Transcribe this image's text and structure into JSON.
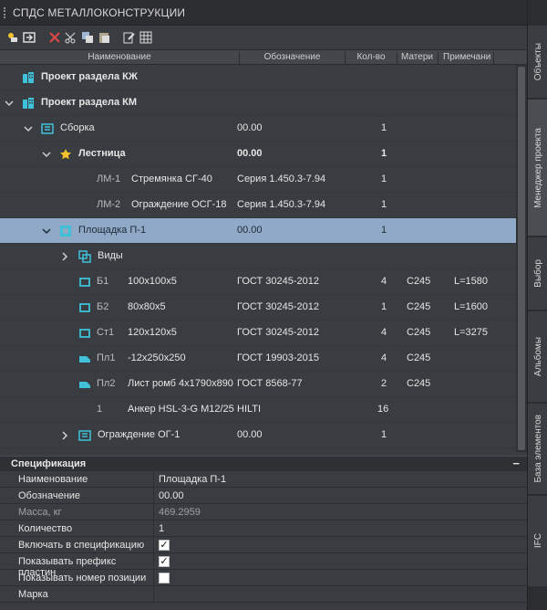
{
  "window": {
    "title": "СПДС МЕТАЛЛОКОНСТРУКЦИИ"
  },
  "columns": {
    "name": "Наименование",
    "designation": "Обозначение",
    "qty": "Кол-во",
    "material": "Матери",
    "note": "Примечани"
  },
  "tree": {
    "rows": [
      {
        "prefix": "",
        "name": "Проект раздела КЖ",
        "designation": "",
        "qty": "",
        "material": "",
        "note": ""
      },
      {
        "prefix": "",
        "name": "Проект раздела КМ",
        "designation": "",
        "qty": "",
        "material": "",
        "note": ""
      },
      {
        "prefix": "",
        "name": "Сборка",
        "designation": "00.00",
        "qty": "1",
        "material": "",
        "note": ""
      },
      {
        "prefix": "",
        "name": "Лестница",
        "designation": "00.00",
        "qty": "1",
        "material": "",
        "note": ""
      },
      {
        "prefix": "ЛМ-1",
        "name": "Стремянка СГ-40",
        "designation": "Серия 1.450.3-7.94",
        "qty": "1",
        "material": "",
        "note": ""
      },
      {
        "prefix": "ЛМ-2",
        "name": "Ограждение ОСГ-18",
        "designation": "Серия 1.450.3-7.94",
        "qty": "1",
        "material": "",
        "note": ""
      },
      {
        "prefix": "",
        "name": "Площадка П-1",
        "designation": "00.00",
        "qty": "1",
        "material": "",
        "note": ""
      },
      {
        "prefix": "",
        "name": "Виды",
        "designation": "",
        "qty": "",
        "material": "",
        "note": ""
      },
      {
        "prefix": "Б1",
        "name": "100x100x5",
        "designation": "ГОСТ 30245-2012",
        "qty": "4",
        "material": "С245",
        "note": "L=1580"
      },
      {
        "prefix": "Б2",
        "name": "80x80x5",
        "designation": "ГОСТ 30245-2012",
        "qty": "1",
        "material": "С245",
        "note": "L=1600"
      },
      {
        "prefix": "Ст1",
        "name": "120x120x5",
        "designation": "ГОСТ 30245-2012",
        "qty": "4",
        "material": "С245",
        "note": "L=3275"
      },
      {
        "prefix": "Пл1",
        "name": "-12x250x250",
        "designation": "ГОСТ 19903-2015",
        "qty": "4",
        "material": "С245",
        "note": ""
      },
      {
        "prefix": "Пл2",
        "name": "Лист ромб 4x1790x890",
        "designation": "ГОСТ 8568-77",
        "qty": "2",
        "material": "С245",
        "note": ""
      },
      {
        "prefix": "1",
        "name": "Анкер HSL-3-G M12/25",
        "designation": "HILTI",
        "qty": "16",
        "material": "",
        "note": ""
      },
      {
        "prefix": "",
        "name": "Ограждение ОГ-1",
        "designation": "00.00",
        "qty": "1",
        "material": "",
        "note": ""
      }
    ]
  },
  "spec": {
    "title": "Спецификация",
    "collapse": "−",
    "props": [
      {
        "key": "Наименование",
        "value": "Площадка П-1"
      },
      {
        "key": "Обозначение",
        "value": "00.00"
      },
      {
        "key": "Масса, кг",
        "value": "469.2959"
      },
      {
        "key": "Количество",
        "value": "1"
      },
      {
        "key": "Включать в спецификацию",
        "value": "✓"
      },
      {
        "key": "Показывать префикс пластин",
        "value": "✓"
      },
      {
        "key": "Показывать номер позиции",
        "value": ""
      },
      {
        "key": "Марка",
        "value": ""
      }
    ]
  },
  "sidetabs": [
    "Объекты",
    "Менеджер проекта",
    "Выбор",
    "Альбомы",
    "База элементов",
    "IFC"
  ],
  "colors": {
    "selected_row": "#8fa9c7",
    "icon_cyan": "#3fc1d9",
    "star": "#f2c12e",
    "delete_red": "#e04848"
  }
}
